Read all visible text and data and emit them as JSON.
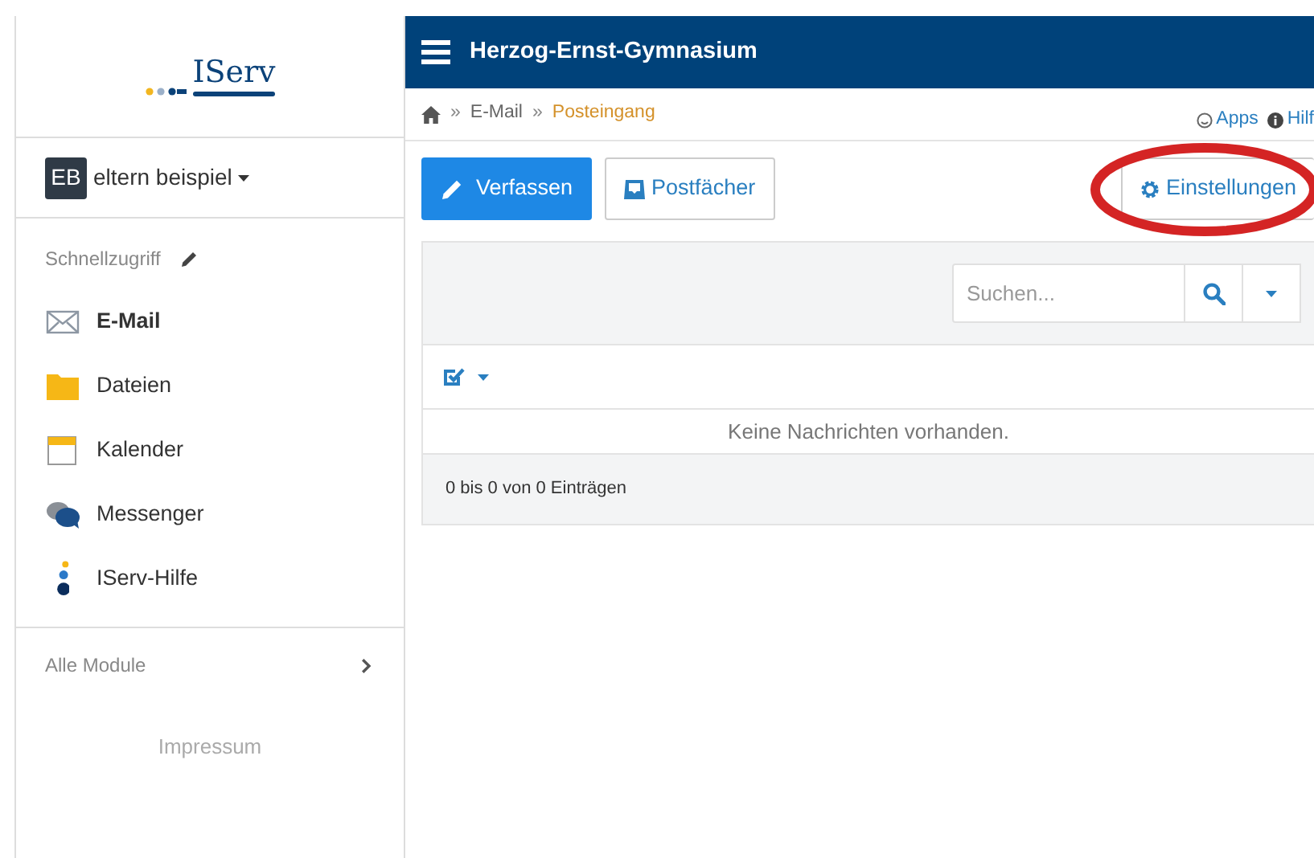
{
  "logo": {
    "text": "IServ"
  },
  "header": {
    "title": "Herzog-Ernst-Gymnasium"
  },
  "user": {
    "initials": "EB",
    "name": "eltern beispiel"
  },
  "sidebar": {
    "quick_access_label": "Schnellzugriff",
    "items": [
      {
        "label": "E-Mail",
        "selected": true
      },
      {
        "label": "Dateien",
        "selected": false
      },
      {
        "label": "Kalender",
        "selected": false
      },
      {
        "label": "Messenger",
        "selected": false
      },
      {
        "label": "IServ-Hilfe",
        "selected": false
      }
    ],
    "all_modules": "Alle Module",
    "footer_link": "Impressum"
  },
  "breadcrumb": [
    {
      "label": "E-Mail",
      "current": false
    },
    {
      "label": "Posteingang",
      "current": true
    }
  ],
  "breadcrumb_separator": "»",
  "top_links": [
    "Apps",
    "Hilf"
  ],
  "toolbar": {
    "compose": "Verfassen",
    "mailboxes": "Postfächer",
    "settings": "Einstellungen"
  },
  "search": {
    "placeholder": "Suchen..."
  },
  "message_list": {
    "empty_text": "Keine Nachrichten vorhanden.",
    "count_text": "0 bis 0 von 0 Einträgen"
  }
}
